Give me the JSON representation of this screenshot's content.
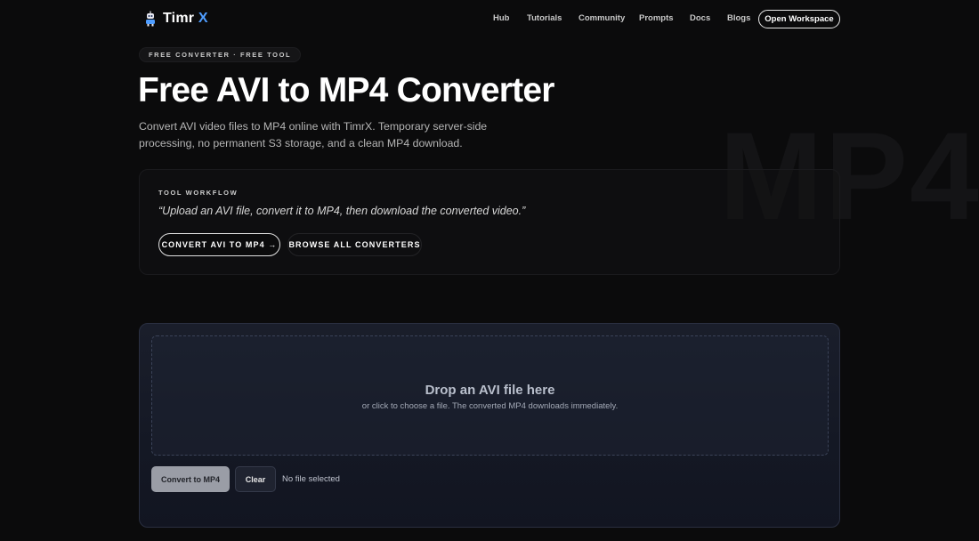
{
  "header": {
    "logo_main": "Timr",
    "logo_accent": "X",
    "nav": [
      {
        "label": "Hub"
      },
      {
        "label": "Tutorials"
      },
      {
        "label": "Community"
      },
      {
        "label": "Prompts"
      },
      {
        "label": "Docs"
      },
      {
        "label": "Blogs"
      }
    ],
    "cta_label": "Open Workspace"
  },
  "hero": {
    "pill": "FREE CONVERTER · FREE TOOL",
    "title": "Free AVI to MP4 Converter",
    "description": "Convert AVI video files to MP4 online with TimrX. Temporary server-side processing, no permanent S3 storage, and a clean MP4 download.",
    "background_mark": "MP4"
  },
  "workflow": {
    "label": "TOOL WORKFLOW",
    "quote": "“Upload an AVI file, convert it to MP4, then download the converted video.”",
    "primary_button": "CONVERT AVI TO MP4 →",
    "secondary_button": "BROWSE ALL CONVERTERS"
  },
  "converter": {
    "drop_title": "Drop an AVI file here",
    "drop_subtitle": "or click to choose a file. The converted MP4 downloads immediately.",
    "convert_button": "Convert to MP4",
    "clear_button": "Clear",
    "file_status": "No file selected"
  },
  "colors": {
    "background": "#0b0b0c",
    "accent": "#4f9dff",
    "panel": "#161a26"
  },
  "icons": {
    "logo": "robot-icon"
  }
}
